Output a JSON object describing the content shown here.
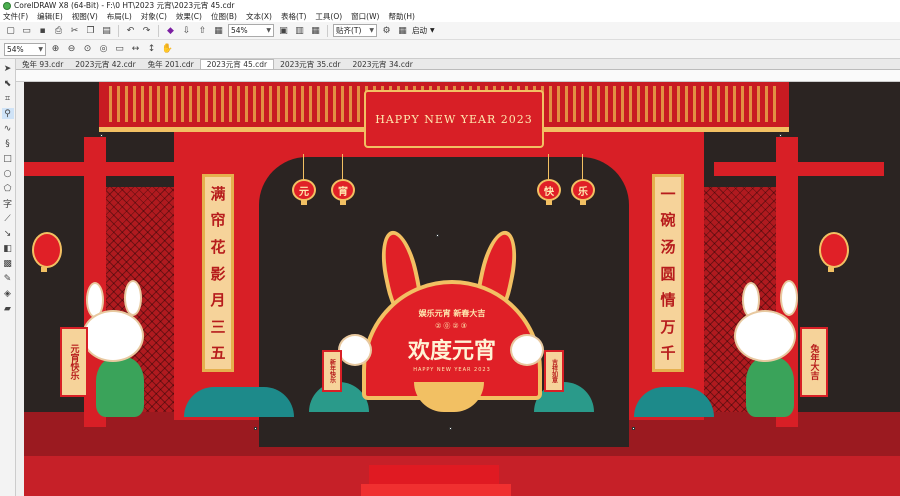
{
  "window": {
    "title": "CorelDRAW X8 (64-Bit) - F:\\0 HT\\2023 元宵\\2023元宵 45.cdr"
  },
  "menu": [
    "文件(F)",
    "编辑(E)",
    "视图(V)",
    "布局(L)",
    "对象(C)",
    "效果(C)",
    "位图(B)",
    "文本(X)",
    "表格(T)",
    "工具(O)",
    "窗口(W)",
    "帮助(H)"
  ],
  "toolbar": {
    "zoom_value": "54%",
    "snap_label": "贴齐(T)",
    "launch_label": "启动"
  },
  "propertybar": {
    "zoom_value": "54%"
  },
  "tabs": [
    {
      "label": "兔年 93.cdr",
      "active": false
    },
    {
      "label": "2023元宵 42.cdr",
      "active": false
    },
    {
      "label": "兔年 201.cdr",
      "active": false
    },
    {
      "label": "2023元宵 45.cdr",
      "active": true
    },
    {
      "label": "2023元宵 35.cdr",
      "active": false
    },
    {
      "label": "2023元宵 34.cdr",
      "active": false
    }
  ],
  "artwork": {
    "banner_text": "HAPPY NEW YEAR 2023",
    "couplet_left": [
      "满",
      "帘",
      "花",
      "影",
      "月",
      "三",
      "五"
    ],
    "couplet_right": [
      "一",
      "碗",
      "汤",
      "圆",
      "情",
      "万",
      "千"
    ],
    "lanterns": [
      "元",
      "宵",
      "快",
      "乐"
    ],
    "board_sub": "娱乐元宵  新春大吉",
    "board_year": "②⓪②③",
    "board_main": "欢度元宵",
    "board_eng": "HAPPY NEW YEAR 2023",
    "scroll_left": "元宵快乐",
    "scroll_right": "兔年大吉",
    "small_scroll_left": "新年快乐",
    "small_scroll_right": "吉祥如意",
    "colors": {
      "red": "#d81f26",
      "gold": "#f2c063",
      "dark": "#2b2422",
      "teal": "#1d8a8a"
    }
  }
}
